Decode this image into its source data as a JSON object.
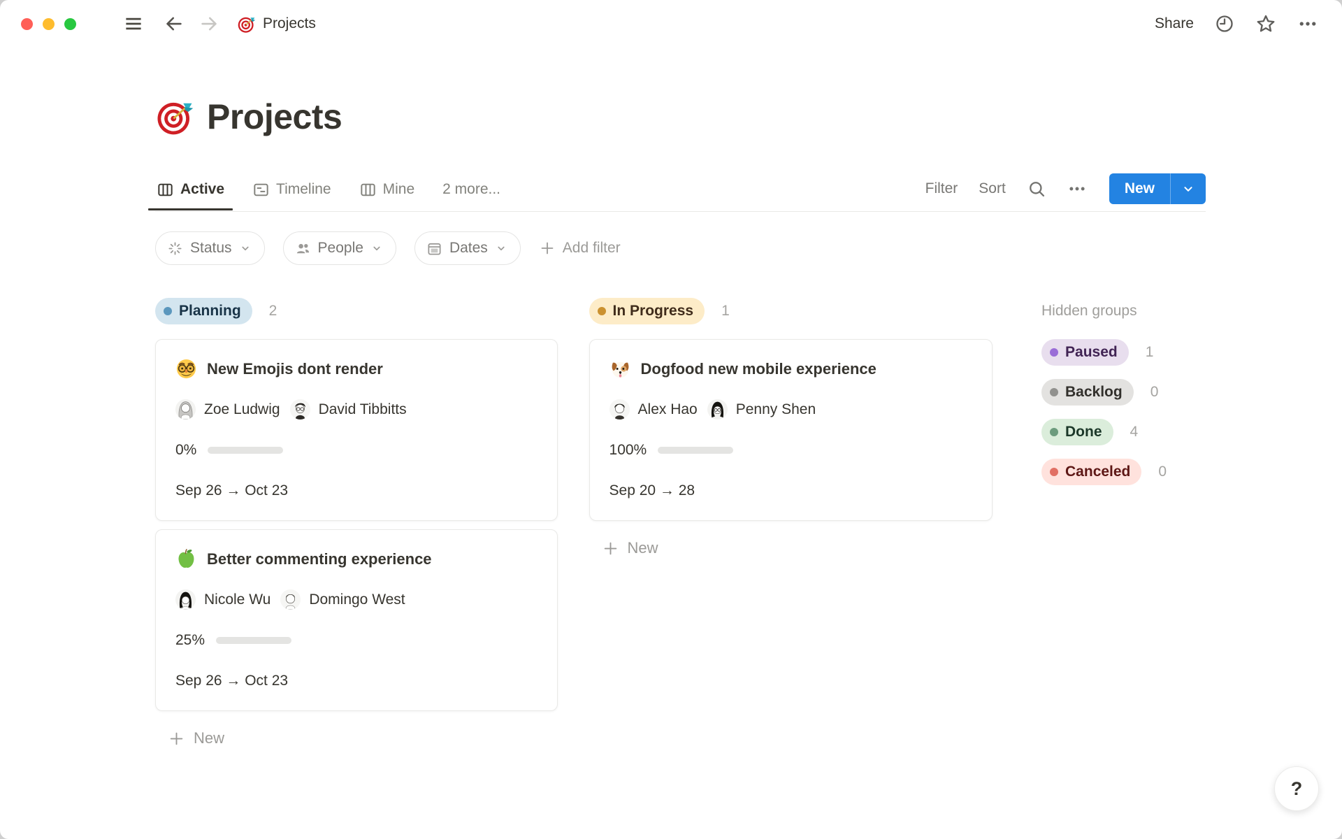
{
  "topbar": {
    "breadcrumb": "Projects",
    "share_label": "Share"
  },
  "page": {
    "title": "Projects"
  },
  "toolbar": {
    "tabs": [
      {
        "label": "Active"
      },
      {
        "label": "Timeline"
      },
      {
        "label": "Mine"
      },
      {
        "label": "2 more..."
      }
    ],
    "filter_label": "Filter",
    "sort_label": "Sort",
    "new_label": "New"
  },
  "filters": {
    "chips": [
      {
        "label": "Status"
      },
      {
        "label": "People"
      },
      {
        "label": "Dates"
      }
    ],
    "add_label": "Add filter"
  },
  "colors": {
    "accent_blue": "#2383e2",
    "progress_green": "#7d9f87",
    "progress_track": "#e4e4e2"
  },
  "board": {
    "columns": [
      {
        "status": {
          "label": "Planning",
          "bg": "#d3e5ef",
          "text": "#183347",
          "dot": "#5b97bd"
        },
        "count": "2",
        "cards": [
          {
            "emoji": "disguised-face",
            "title": "New Emojis dont  render",
            "assignees": [
              {
                "name": "Zoe Ludwig"
              },
              {
                "name": "David Tibbitts"
              }
            ],
            "progress": 0,
            "progress_label": "0%",
            "dates": "Sep 26 → Oct 23"
          },
          {
            "emoji": "green-apple",
            "title": "Better commenting experience",
            "assignees": [
              {
                "name": "Nicole Wu"
              },
              {
                "name": "Domingo West"
              }
            ],
            "progress": 25,
            "progress_label": "25%",
            "dates": "Sep 26 → Oct 23"
          }
        ],
        "new_label": "New"
      },
      {
        "status": {
          "label": "In Progress",
          "bg": "#fdecc8",
          "text": "#402c1b",
          "dot": "#cb912f"
        },
        "count": "1",
        "cards": [
          {
            "emoji": "dog-face",
            "title": "Dogfood new mobile experience",
            "assignees": [
              {
                "name": "Alex Hao"
              },
              {
                "name": "Penny Shen"
              }
            ],
            "progress": 100,
            "progress_label": "100%",
            "dates": "Sep 20 → 28"
          }
        ],
        "new_label": "New"
      }
    ],
    "hidden_groups": {
      "title": "Hidden groups",
      "groups": [
        {
          "status": {
            "label": "Paused",
            "bg": "#e8deee",
            "text": "#412454",
            "dot": "#9a6dd7"
          },
          "count": "1"
        },
        {
          "status": {
            "label": "Backlog",
            "bg": "#e3e2e0",
            "text": "#32302c",
            "dot": "#91918e"
          },
          "count": "0"
        },
        {
          "status": {
            "label": "Done",
            "bg": "#dbeddb",
            "text": "#1c3829",
            "dot": "#6c9b7d"
          },
          "count": "4"
        },
        {
          "status": {
            "label": "Canceled",
            "bg": "#ffe2dd",
            "text": "#5d1715",
            "dot": "#e16f64"
          },
          "count": "0"
        }
      ]
    }
  },
  "help": {
    "label": "?"
  }
}
